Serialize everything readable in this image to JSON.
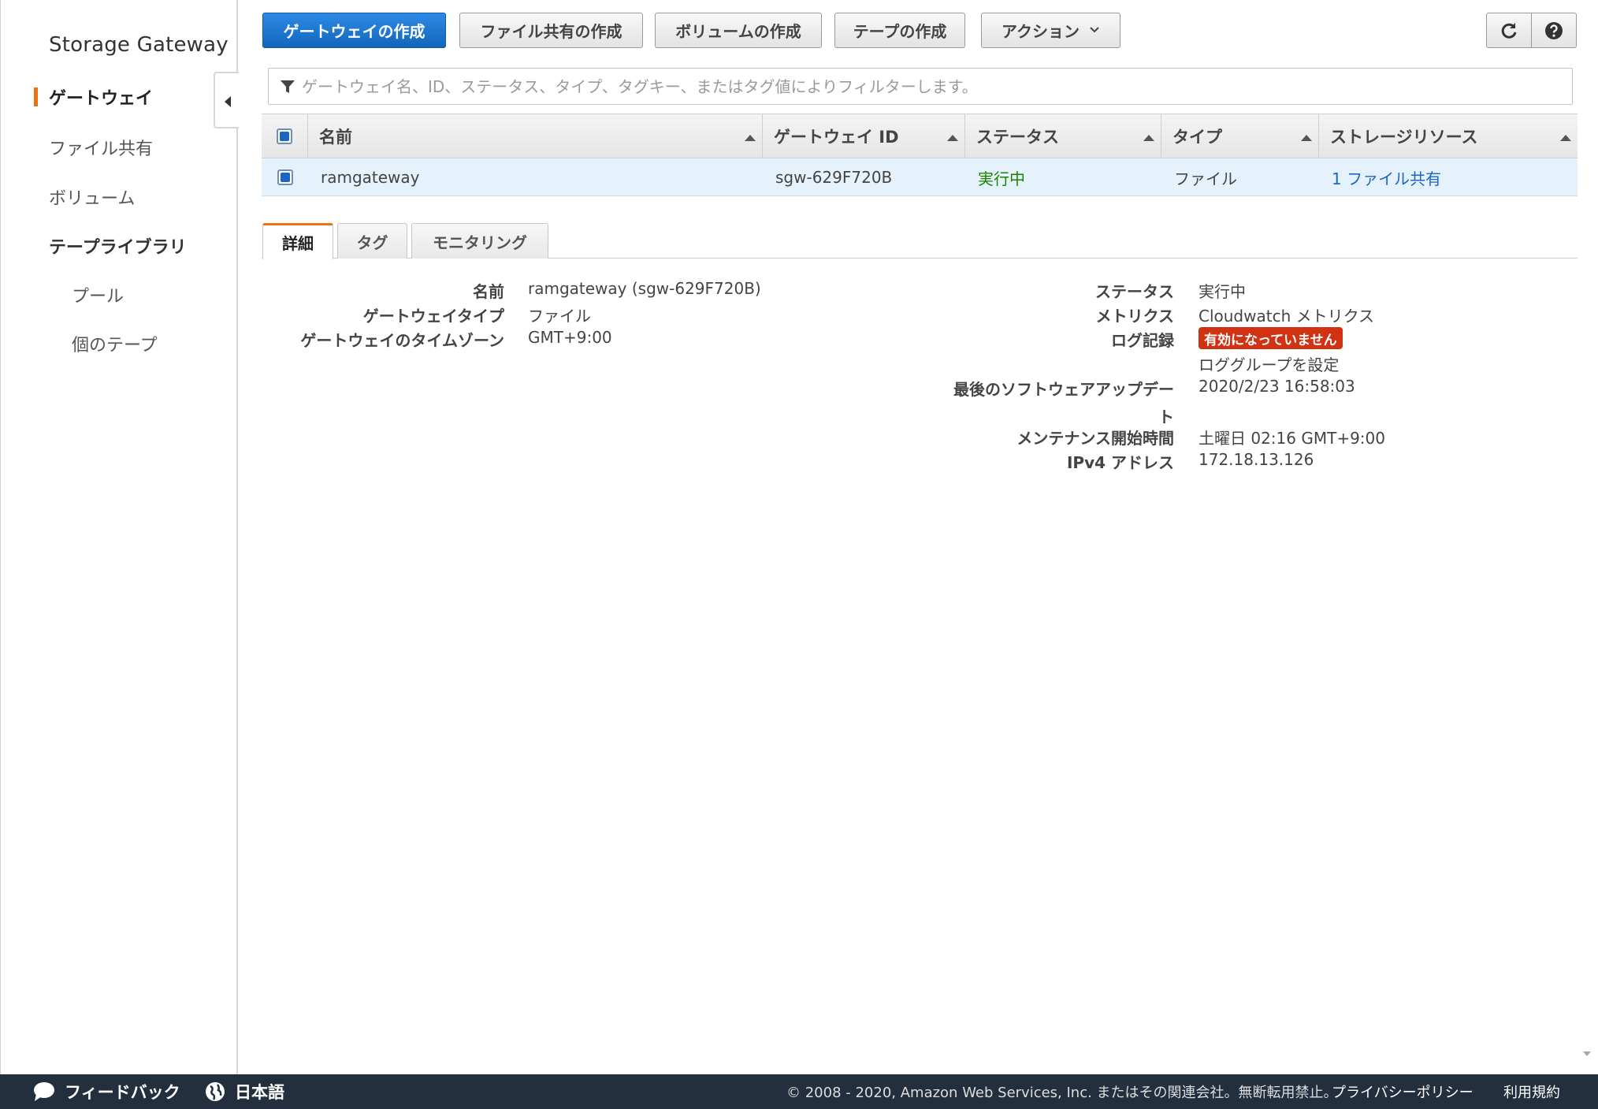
{
  "sidebar": {
    "title": "Storage Gateway",
    "items": [
      {
        "label": "ゲートウェイ"
      },
      {
        "label": "ファイル共有"
      },
      {
        "label": "ボリューム"
      },
      {
        "label": "テープライブラリ"
      },
      {
        "label": "プール"
      },
      {
        "label": "個のテープ"
      }
    ]
  },
  "toolbar": {
    "create_gateway": "ゲートウェイの作成",
    "create_file_share": "ファイル共有の作成",
    "create_volume": "ボリュームの作成",
    "create_tape": "テープの作成",
    "actions": "アクション",
    "refresh_icon": "refresh-icon",
    "help_icon": "help-icon"
  },
  "filter": {
    "placeholder": "ゲートウェイ名、ID、ステータス、タイプ、タグキー、またはタグ値によりフィルターします。"
  },
  "table": {
    "columns": [
      "名前",
      "ゲートウェイ ID",
      "ステータス",
      "タイプ",
      "ストレージリソース"
    ],
    "rows": [
      {
        "name": "ramgateway",
        "gateway_id": "sgw-629F720B",
        "status": "実行中",
        "type": "ファイル",
        "storage": "1 ファイル共有"
      }
    ]
  },
  "tabs": [
    "詳細",
    "タグ",
    "モニタリング"
  ],
  "details": {
    "left": {
      "name_label": "名前",
      "name_value": "ramgateway (sgw-629F720B)",
      "type_label": "ゲートウェイタイプ",
      "type_value": "ファイル",
      "tz_label": "ゲートウェイのタイムゾーン",
      "tz_value": "GMT+9:00"
    },
    "right": {
      "status_label": "ステータス",
      "status_value": "実行中",
      "metrics_label": "メトリクス",
      "metrics_value": "Cloudwatch メトリクス",
      "log_label": "ログ記録",
      "log_badge": "有効になっていません",
      "log_link": "ロググループを設定",
      "update_label_line1": "最後のソフトウェアアップデー",
      "update_label_line2": "ト",
      "update_value": "2020/2/23 16:58:03",
      "maint_label": "メンテナンス開始時間",
      "maint_value": "土曜日 02:16 GMT+9:00",
      "ip_label": "IPv4 アドレス",
      "ip_value": "172.18.13.126"
    }
  },
  "footer": {
    "feedback": "フィードバック",
    "language": "日本語",
    "copyright": "© 2008 - 2020, Amazon Web Services, Inc. またはその関連会社。無断転用禁止。",
    "privacy": "プライバシーポリシー",
    "terms": "利用規約"
  },
  "colors": {
    "accent": "#ec7211",
    "primary_button": "#1a66c2",
    "link": "#1a66c2",
    "status_green": "#1d8102",
    "badge_red": "#d13212",
    "footer_bg": "#232f3e"
  }
}
